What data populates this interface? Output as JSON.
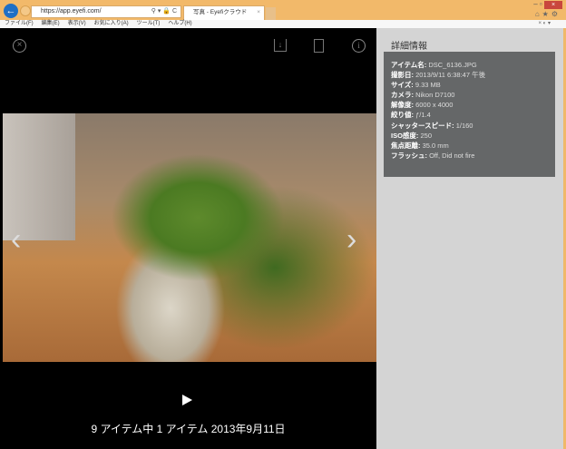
{
  "browser": {
    "url": "https://app.eyefi.com/",
    "tab_title": "写真 - Eyefiクラウド",
    "menu": [
      "ファイル(F)",
      "編集(E)",
      "表示(V)",
      "お気に入り(A)",
      "ツール(T)",
      "ヘルプ(H)"
    ]
  },
  "viewer": {
    "caption": "9 アイテム中 1 アイテム  2013年9月11日"
  },
  "panel": {
    "title": "詳細情報",
    "rows": [
      {
        "label": "アイテム名:",
        "value": " DSC_6136.JPG"
      },
      {
        "label": "撮影日:",
        "value": " 2013/9/11 6:38:47 午後"
      },
      {
        "label": "サイズ:",
        "value": " 9.33 MB"
      },
      {
        "label": "カメラ:",
        "value": " Nikon D7100"
      },
      {
        "label": "解像度:",
        "value": " 6000 x 4000"
      },
      {
        "label": "絞り値:",
        "value": " ƒ/1.4"
      },
      {
        "label": "シャッタースピード:",
        "value": " 1/160"
      },
      {
        "label": "ISO感度:",
        "value": " 250"
      },
      {
        "label": "焦点距離:",
        "value": " 35.0 mm"
      },
      {
        "label": "フラッシュ:",
        "value": " Off, Did not fire"
      }
    ]
  }
}
